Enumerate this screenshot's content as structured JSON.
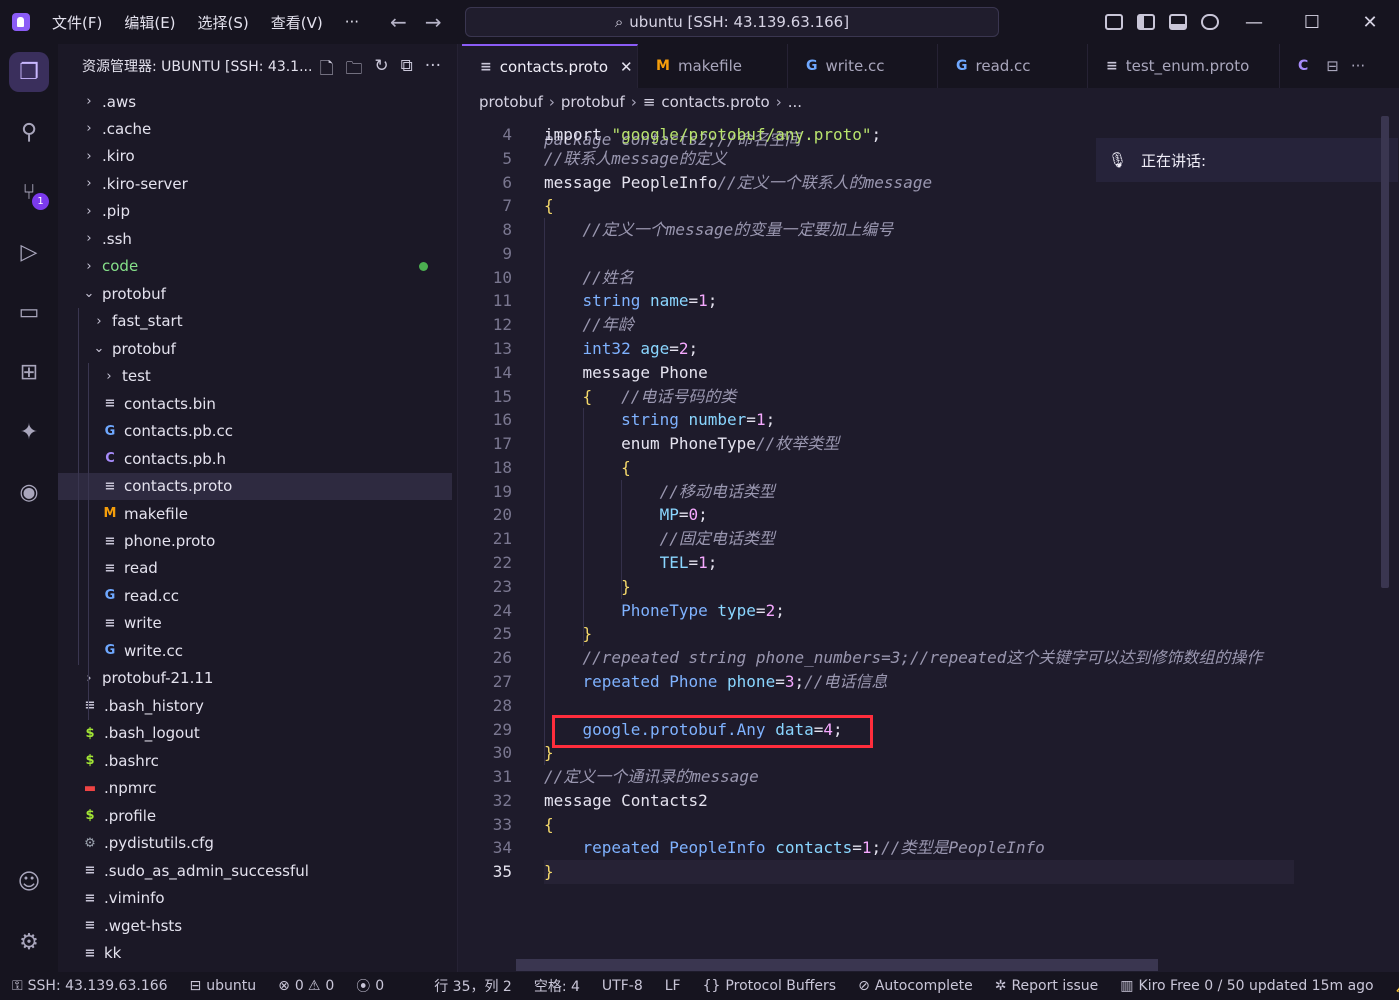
{
  "titlebar": {
    "menus": [
      "文件(F)",
      "编辑(E)",
      "选择(S)",
      "查看(V)",
      "···"
    ],
    "search": "ubuntu [SSH: 43.139.63.166]",
    "window_controls": [
      "—",
      "☐",
      "✕"
    ]
  },
  "activity": {
    "scm_badge": "1"
  },
  "sidebar": {
    "title": "资源管理器: UBUNTU [SSH: 43.1..."
  },
  "tree": [
    {
      "label": ".aws",
      "kind": "folder",
      "depth": 0,
      "open": false
    },
    {
      "label": ".cache",
      "kind": "folder",
      "depth": 0,
      "open": false
    },
    {
      "label": ".kiro",
      "kind": "folder",
      "depth": 0,
      "open": false
    },
    {
      "label": ".kiro-server",
      "kind": "folder",
      "depth": 0,
      "open": false
    },
    {
      "label": ".pip",
      "kind": "folder",
      "depth": 0,
      "open": false
    },
    {
      "label": ".ssh",
      "kind": "folder",
      "depth": 0,
      "open": false
    },
    {
      "label": "code",
      "kind": "folder",
      "depth": 0,
      "open": false,
      "modified": true
    },
    {
      "label": "protobuf",
      "kind": "folder",
      "depth": 0,
      "open": true
    },
    {
      "label": "fast_start",
      "kind": "folder",
      "depth": 1,
      "open": false
    },
    {
      "label": "protobuf",
      "kind": "folder",
      "depth": 1,
      "open": true
    },
    {
      "label": "test",
      "kind": "folder",
      "depth": 2,
      "open": false
    },
    {
      "label": "contacts.bin",
      "kind": "text",
      "depth": 2
    },
    {
      "label": "contacts.pb.cc",
      "kind": "cpp",
      "depth": 2
    },
    {
      "label": "contacts.pb.h",
      "kind": "c",
      "depth": 2
    },
    {
      "label": "contacts.proto",
      "kind": "text",
      "depth": 2,
      "selected": true
    },
    {
      "label": "makefile",
      "kind": "make",
      "depth": 2
    },
    {
      "label": "phone.proto",
      "kind": "text",
      "depth": 2
    },
    {
      "label": "read",
      "kind": "text",
      "depth": 2
    },
    {
      "label": "read.cc",
      "kind": "cpp",
      "depth": 2
    },
    {
      "label": "write",
      "kind": "text",
      "depth": 2
    },
    {
      "label": "write.cc",
      "kind": "cpp",
      "depth": 2
    },
    {
      "label": "protobuf-21.11",
      "kind": "folder",
      "depth": 0,
      "open": false
    },
    {
      "label": ".bash_history",
      "kind": "text",
      "depth": 0
    },
    {
      "label": ".bash_logout",
      "kind": "shell",
      "depth": 0
    },
    {
      "label": ".bashrc",
      "kind": "shell",
      "depth": 0
    },
    {
      "label": ".npmrc",
      "kind": "npm",
      "depth": 0
    },
    {
      "label": ".profile",
      "kind": "shell",
      "depth": 0
    },
    {
      "label": ".pydistutils.cfg",
      "kind": "gear",
      "depth": 0
    },
    {
      "label": ".sudo_as_admin_successful",
      "kind": "text",
      "depth": 0
    },
    {
      "label": ".viminfo",
      "kind": "text",
      "depth": 0
    },
    {
      "label": ".wget-hsts",
      "kind": "text",
      "depth": 0
    },
    {
      "label": "kk",
      "kind": "text",
      "depth": 0
    }
  ],
  "tabs": [
    {
      "label": "contacts.proto",
      "kind": "text",
      "active": true,
      "close": "✕"
    },
    {
      "label": "makefile",
      "kind": "make"
    },
    {
      "label": "write.cc",
      "kind": "cpp"
    },
    {
      "label": "read.cc",
      "kind": "cpp"
    },
    {
      "label": "test_enum.proto",
      "kind": "text"
    }
  ],
  "tab_overflow_icon": "C",
  "breadcrumb": [
    "protobuf",
    "protobuf",
    "contacts.proto",
    "..."
  ],
  "editor": {
    "partial_top_line": "package contacts2;//命名空间",
    "current_line": 35,
    "lines": [
      {
        "n": 4,
        "t": [
          [
            "kw",
            "import "
          ],
          [
            "str",
            "\"google/protobuf/any.proto\""
          ],
          [
            "pn",
            ";"
          ]
        ]
      },
      {
        "n": 5,
        "t": [
          [
            "cm",
            "//联系人message的定义"
          ]
        ]
      },
      {
        "n": 6,
        "t": [
          [
            "kw",
            "message "
          ],
          [
            "pn",
            "PeopleInfo"
          ],
          [
            "cm",
            "//定义一个联系人的message"
          ]
        ]
      },
      {
        "n": 7,
        "t": [
          [
            "br",
            "{"
          ]
        ]
      },
      {
        "n": 8,
        "t": [
          [
            "cm",
            "    //定义一个message的变量一定要加上编号"
          ]
        ]
      },
      {
        "n": 9,
        "t": []
      },
      {
        "n": 10,
        "t": [
          [
            "cm",
            "    //姓名"
          ]
        ]
      },
      {
        "n": 11,
        "t": [
          [
            "ty",
            "    string "
          ],
          [
            "fld",
            "name"
          ],
          [
            "pn",
            "="
          ],
          [
            "num",
            "1"
          ],
          [
            "pn",
            ";"
          ]
        ]
      },
      {
        "n": 12,
        "t": [
          [
            "cm",
            "    //年龄"
          ]
        ]
      },
      {
        "n": 13,
        "t": [
          [
            "ty",
            "    int32 "
          ],
          [
            "fld",
            "age"
          ],
          [
            "pn",
            "="
          ],
          [
            "num",
            "2"
          ],
          [
            "pn",
            ";"
          ]
        ]
      },
      {
        "n": 14,
        "t": [
          [
            "kw",
            "    message "
          ],
          [
            "pn",
            "Phone"
          ]
        ]
      },
      {
        "n": 15,
        "t": [
          [
            "br",
            "    {"
          ],
          [
            "cm",
            "   //电话号码的类"
          ]
        ]
      },
      {
        "n": 16,
        "t": [
          [
            "ty",
            "        string "
          ],
          [
            "fld",
            "number"
          ],
          [
            "pn",
            "="
          ],
          [
            "num",
            "1"
          ],
          [
            "pn",
            ";"
          ]
        ]
      },
      {
        "n": 17,
        "t": [
          [
            "kw",
            "        enum "
          ],
          [
            "pn",
            "PhoneType"
          ],
          [
            "cm",
            "//枚举类型"
          ]
        ]
      },
      {
        "n": 18,
        "t": [
          [
            "br",
            "        {"
          ]
        ]
      },
      {
        "n": 19,
        "t": [
          [
            "cm",
            "            //移动电话类型"
          ]
        ]
      },
      {
        "n": 20,
        "t": [
          [
            "fld",
            "            MP"
          ],
          [
            "pn",
            "="
          ],
          [
            "num",
            "0"
          ],
          [
            "pn",
            ";"
          ]
        ]
      },
      {
        "n": 21,
        "t": [
          [
            "cm",
            "            //固定电话类型"
          ]
        ]
      },
      {
        "n": 22,
        "t": [
          [
            "fld",
            "            TEL"
          ],
          [
            "pn",
            "="
          ],
          [
            "num",
            "1"
          ],
          [
            "pn",
            ";"
          ]
        ]
      },
      {
        "n": 23,
        "t": [
          [
            "br",
            "        }"
          ]
        ]
      },
      {
        "n": 24,
        "t": [
          [
            "ty",
            "        PhoneType "
          ],
          [
            "fld",
            "type"
          ],
          [
            "pn",
            "="
          ],
          [
            "num",
            "2"
          ],
          [
            "pn",
            ";"
          ]
        ]
      },
      {
        "n": 25,
        "t": [
          [
            "br",
            "    }"
          ]
        ]
      },
      {
        "n": 26,
        "t": [
          [
            "cm",
            "    //repeated string phone_numbers=3;//repeated这个关键字可以达到修饰数组的操作"
          ]
        ]
      },
      {
        "n": 27,
        "t": [
          [
            "ty",
            "    repeated Phone "
          ],
          [
            "fld",
            "phone"
          ],
          [
            "pn",
            "="
          ],
          [
            "num",
            "3"
          ],
          [
            "pn",
            ";"
          ],
          [
            "cm",
            "//电话信息"
          ]
        ]
      },
      {
        "n": 28,
        "t": []
      },
      {
        "n": 29,
        "t": [
          [
            "ty",
            "    google.protobuf.Any "
          ],
          [
            "fld",
            "data"
          ],
          [
            "pn",
            "="
          ],
          [
            "num",
            "4"
          ],
          [
            "pn",
            ";"
          ]
        ]
      },
      {
        "n": 30,
        "t": [
          [
            "br",
            "}"
          ]
        ]
      },
      {
        "n": 31,
        "t": [
          [
            "cm",
            "//定义一个通讯录的message"
          ]
        ]
      },
      {
        "n": 32,
        "t": [
          [
            "kw",
            "message "
          ],
          [
            "pn",
            "Contacts2"
          ]
        ]
      },
      {
        "n": 33,
        "t": [
          [
            "br",
            "{"
          ]
        ]
      },
      {
        "n": 34,
        "t": [
          [
            "ty",
            "    repeated PeopleInfo "
          ],
          [
            "fld",
            "contacts"
          ],
          [
            "pn",
            "="
          ],
          [
            "num",
            "1"
          ],
          [
            "pn",
            ";"
          ],
          [
            "cm",
            "//类型是PeopleInfo"
          ]
        ]
      },
      {
        "n": 35,
        "t": [
          [
            "br",
            "}"
          ]
        ]
      }
    ]
  },
  "toast": {
    "label": "正在讲话:"
  },
  "statusbar": {
    "remote": "SSH: 43.139.63.166",
    "workspace": "ubuntu",
    "errors": "0",
    "warnings": "0",
    "ports": "0",
    "position": "行 35，列 2",
    "spaces": "空格: 4",
    "encoding": "UTF-8",
    "eol": "LF",
    "language": "Protocol Buffers",
    "autocomplete": "Autocomplete",
    "report": "Report issue",
    "kiro": "Kiro Free 0 / 50 updated 15m ago"
  },
  "colors": {
    "accent": "#8b5cf6",
    "highlight_box": "#ff2d3c",
    "modified_dot": "#4caf50"
  }
}
